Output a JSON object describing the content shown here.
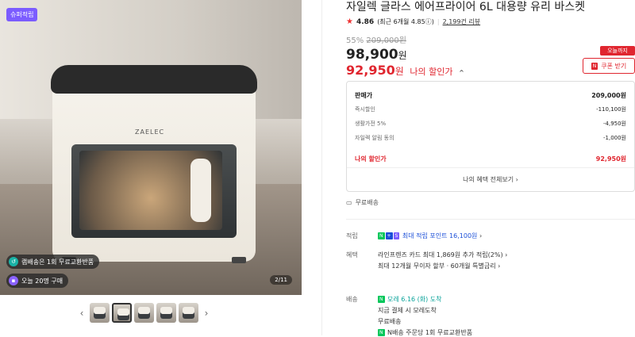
{
  "gallery": {
    "badge": "슈퍼적립",
    "logo": "ZAELEC",
    "promo_return": "램배송은 1회 무료교환반품",
    "promo_buyers": "오늘 20명 구매",
    "counter": "2/11",
    "thumb_count": 5
  },
  "product": {
    "title": "자일렉 글라스 에어프라이어 6L 대용량 유리 바스켓",
    "rating": "4.86",
    "rating_detail": "(최근 6개월 4.85ⓘ)",
    "review_count": "2,199건 리뷰",
    "discount_rate": "55%",
    "original_price": "209,000원",
    "price": "98,900",
    "price_unit": "원",
    "my_price": "92,950",
    "my_price_unit": "원",
    "my_price_label": "나의 할인가",
    "coupon_tag": "오늘까지",
    "coupon_label": "쿠폰 받기"
  },
  "price_box": {
    "rows": [
      {
        "label": "판매가",
        "value": "209,000원"
      },
      {
        "label": "즉시할인",
        "value": "-110,100원"
      },
      {
        "label": "생활가전 5%",
        "value": "-4,950원"
      },
      {
        "label": "자일렉 알림 동의",
        "value": "-1,000원"
      }
    ],
    "mine_label": "나의 할인가",
    "mine_value": "92,950원",
    "benefit_link": "나의 혜택 전체보기"
  },
  "shipping_free": "무료배송",
  "points": {
    "label": "적립",
    "text": "최대 적립 포인트 16,100원"
  },
  "benefits": {
    "label": "혜택",
    "line1": "라인프렌즈 카드 최대 1,869원 추가 적립(2%)",
    "line2": "최대 12개월 무이자 할부 · 60개월 특별금리"
  },
  "delivery": {
    "label": "배송",
    "arrive": "모레 6.16 (화) 도착",
    "line1": "지금 결제 시 모레도착",
    "line2": "무료배송",
    "line3": "N배송 주문당 1회 무료교환반품"
  },
  "colors": {
    "accent": "#e0262f",
    "link": "#1b4fd8",
    "badge": "#7b5cff"
  }
}
